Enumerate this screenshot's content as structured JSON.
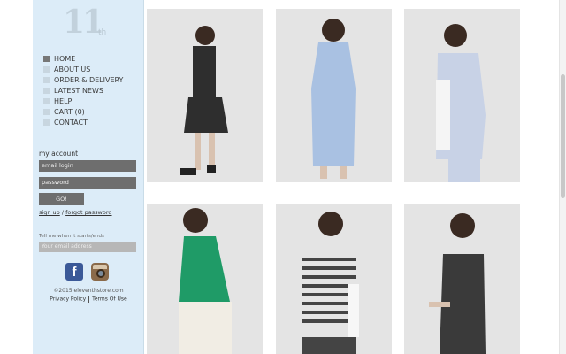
{
  "logo": {
    "mark": "11",
    "suffix": "th"
  },
  "nav": [
    {
      "label": "HOME"
    },
    {
      "label": "ABOUT US"
    },
    {
      "label": "ORDER & DELIVERY"
    },
    {
      "label": "LATEST NEWS"
    },
    {
      "label": "HELP"
    },
    {
      "label": "CART (0)"
    },
    {
      "label": "CONTACT"
    }
  ],
  "account": {
    "title": "my account",
    "login_placeholder": "email login",
    "password_placeholder": "password",
    "go_label": "GO!",
    "signup": "sign up",
    "slash": "/",
    "forgot": "forgot password"
  },
  "newsletter": {
    "label": "Tell me when it starts/ends",
    "placeholder": "Your email address"
  },
  "social": {
    "facebook_glyph": "f"
  },
  "footer": {
    "copyright": "©2015 eleventhstore.com",
    "privacy": "Privacy Policy",
    "terms": "Terms Of Use"
  },
  "products": [
    {
      "name": "photo-black-dress",
      "colors": {
        "top": "#2e2e2e",
        "bottom": "#2e2e2e"
      }
    },
    {
      "name": "photo-blue-dress",
      "colors": {
        "top": "#a9c1e2",
        "bottom": "#a9c1e2"
      }
    },
    {
      "name": "photo-striped-shirt",
      "colors": {
        "top": "#c8d2e6",
        "bottom": "#c8d2e6"
      }
    },
    {
      "name": "photo-green-top",
      "colors": {
        "top": "#1f9b67",
        "bottom": "#f1ede4"
      }
    },
    {
      "name": "photo-striped-top",
      "colors": {
        "top": "#e6e6e6",
        "bottom": "#444444"
      }
    },
    {
      "name": "photo-black-top",
      "colors": {
        "top": "#3a3a3a",
        "bottom": "#3a3a3a"
      }
    }
  ]
}
